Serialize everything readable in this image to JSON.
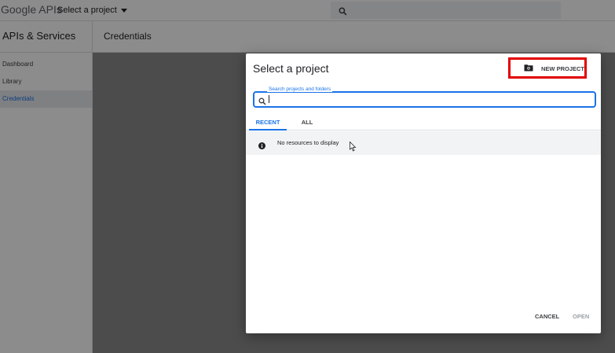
{
  "header": {
    "logo_text": "Google APIs",
    "project_selector_label": "Select a project"
  },
  "sidebar": {
    "title": "APIs & Services",
    "items": [
      {
        "label": "Dashboard"
      },
      {
        "label": "Library"
      },
      {
        "label": "Credentials",
        "active": true
      }
    ]
  },
  "content": {
    "title": "Credentials"
  },
  "dialog": {
    "title": "Select a project",
    "new_project_label": "NEW PROJECT",
    "search": {
      "label": "Search projects and folders",
      "value": ""
    },
    "tabs": [
      {
        "label": "RECENT",
        "active": true
      },
      {
        "label": "ALL",
        "active": false
      }
    ],
    "empty_message": "No resources to display",
    "cancel_label": "CANCEL",
    "open_label": "OPEN"
  },
  "colors": {
    "accent": "#1a73e8",
    "highlight": "#e30000"
  },
  "icons": {
    "search": "search-icon",
    "info": "info-icon",
    "new_project": "folder-plus-icon",
    "caret": "caret-down-icon"
  }
}
